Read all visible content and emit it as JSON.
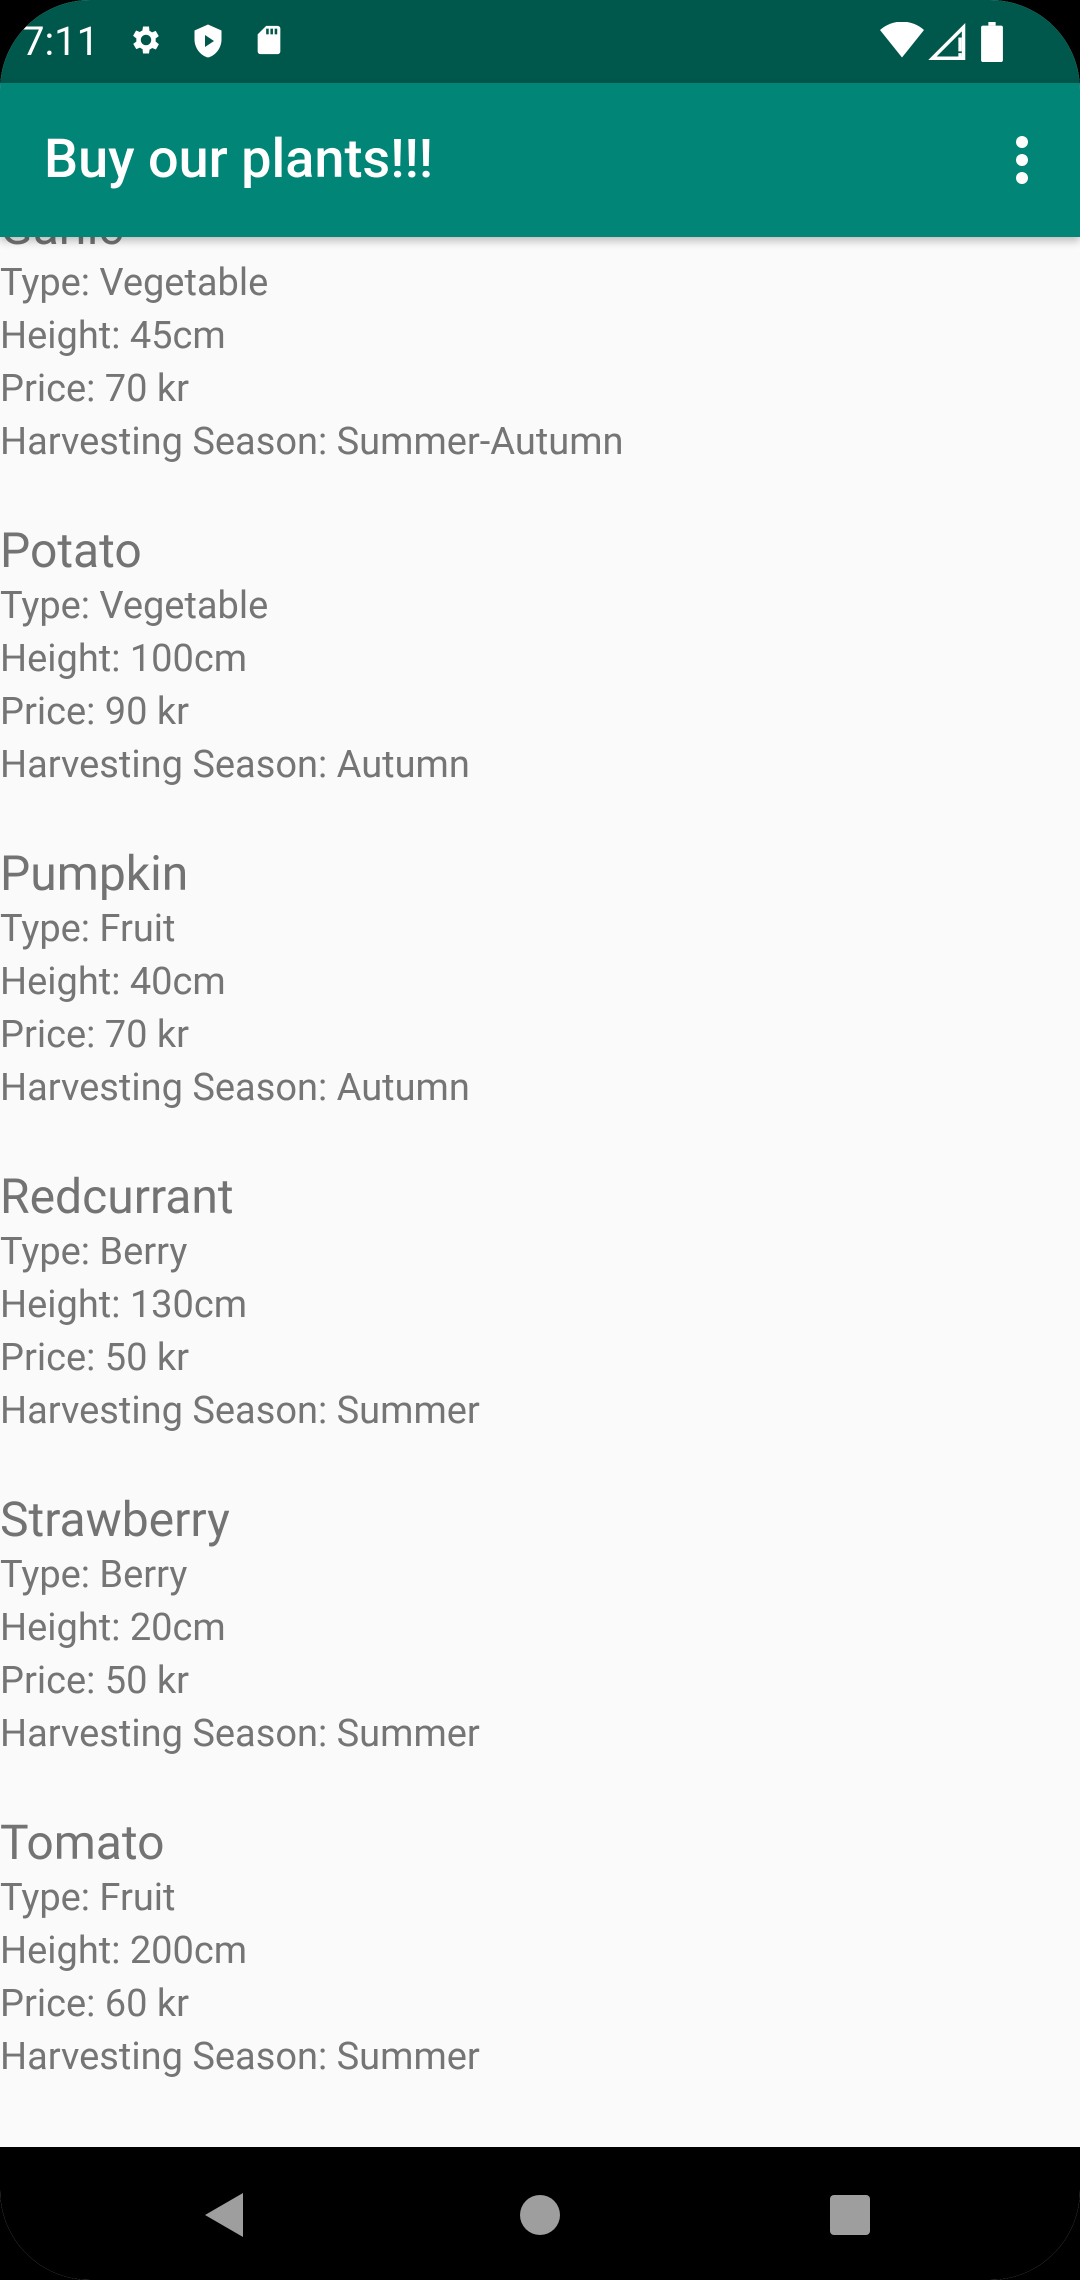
{
  "status_bar": {
    "time": "7:11",
    "left_icons": [
      "gear-icon",
      "shield-icon",
      "sd-card-icon"
    ],
    "right_icons": [
      "wifi-icon",
      "cell-signal-icon",
      "battery-icon"
    ]
  },
  "app_bar": {
    "title": "Buy our plants!!!",
    "menu_icon": "more-vert-icon",
    "color": "#008577",
    "status_color": "#00574b"
  },
  "plants": [
    {
      "name": "Garlic",
      "type": "Type: Vegetable",
      "height": "Height: 45cm",
      "price": "Price: 70 kr",
      "season": "Harvesting Season: Summer-Autumn"
    },
    {
      "name": "Potato",
      "type": "Type: Vegetable",
      "height": "Height: 100cm",
      "price": "Price: 90 kr",
      "season": "Harvesting Season: Autumn"
    },
    {
      "name": "Pumpkin",
      "type": "Type: Fruit",
      "height": "Height: 40cm",
      "price": "Price: 70 kr",
      "season": "Harvesting Season: Autumn"
    },
    {
      "name": "Redcurrant",
      "type": "Type: Berry",
      "height": "Height: 130cm",
      "price": "Price: 50 kr",
      "season": "Harvesting Season: Summer"
    },
    {
      "name": "Strawberry",
      "type": "Type: Berry",
      "height": "Height: 20cm",
      "price": "Price: 50 kr",
      "season": "Harvesting Season: Summer"
    },
    {
      "name": "Tomato",
      "type": "Type: Fruit",
      "height": "Height: 200cm",
      "price": "Price: 60 kr",
      "season": "Harvesting Season: Summer"
    }
  ],
  "nav_bar": {
    "back_icon": "back-triangle-icon",
    "home_icon": "home-circle-icon",
    "recents_icon": "recents-square-icon"
  }
}
